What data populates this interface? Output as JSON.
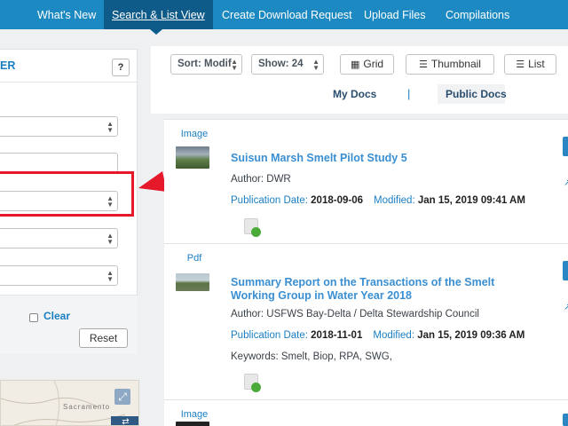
{
  "nav": {
    "items": [
      "What's New",
      "Search & List View",
      "Create Download Request",
      "Upload Files",
      "Compilations"
    ],
    "active_index": 1
  },
  "filter_panel": {
    "title": "ER",
    "help_label": "?",
    "clear_label": "Clear",
    "reset_label": "Reset"
  },
  "map": {
    "city_label": "Sacramento",
    "expand_icon": "expand-icon",
    "layers_icon": "layers-icon"
  },
  "toolbar": {
    "sort_label": "Sort: Modif",
    "show_label": "Show: 24",
    "grid_label": "Grid",
    "thumbnail_label": "Thumbnail",
    "list_label": "List"
  },
  "docs_tabs": {
    "my_docs": "My Docs",
    "separator": "|",
    "public_docs": "Public Docs"
  },
  "results": [
    {
      "type": "Image",
      "title": "Suisun Marsh Smelt Pilot Study 5",
      "author": "Author: DWR",
      "pub_label": "Publication Date:",
      "pub_date": "2018-09-06",
      "mod_label": "Modified:",
      "mod_date": "Jan 15, 2019 09:41 AM"
    },
    {
      "type": "Pdf",
      "title": "Summary Report on the Transactions of the Smelt Working Group in Water Year 2018",
      "author": "Author: USFWS Bay-Delta / Delta Stewardship Council",
      "pub_label": "Publication Date:",
      "pub_date": "2018-11-01",
      "mod_label": "Modified:",
      "mod_date": "Jan 15, 2019 09:36 AM",
      "keywords": "Keywords: Smelt, Biop, RPA, SWG,"
    },
    {
      "type": "Image"
    }
  ],
  "colors": {
    "nav_bg": "#1c89c2",
    "nav_active": "#0e5b8a",
    "link_blue": "#1a7fc1",
    "highlight_red": "#e5192a"
  }
}
